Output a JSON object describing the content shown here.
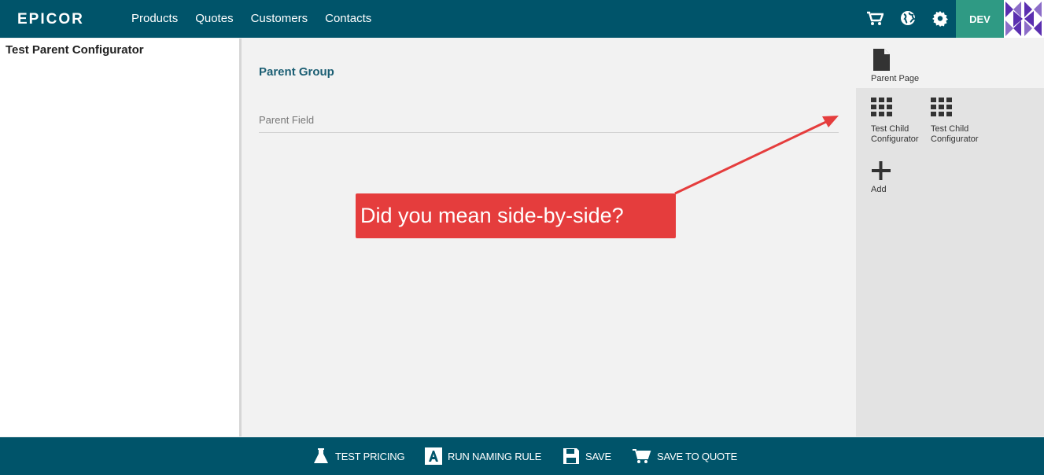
{
  "header": {
    "logo_text": "EPICOR",
    "nav": [
      "Products",
      "Quotes",
      "Customers",
      "Contacts"
    ],
    "env_badge": "DEV",
    "icons": [
      "cart-icon",
      "globe-icon",
      "gear-icon"
    ]
  },
  "sidebar": {
    "title": "Test Parent Configurator"
  },
  "main": {
    "group_title": "Parent Group",
    "field_label": "Parent Field"
  },
  "right_panel": {
    "page_label": "Parent Page",
    "children": [
      {
        "label_line1": "Test Child",
        "label_line2": "Configurator"
      },
      {
        "label_line1": "Test Child",
        "label_line2": "Configurator"
      }
    ],
    "add_label": "Add"
  },
  "footer": {
    "buttons": [
      "TEST PRICING",
      "RUN NAMING RULE",
      "SAVE",
      "SAVE TO QUOTE"
    ]
  },
  "annotation": {
    "text": "Did you mean side-by-side?",
    "color": "#e53d3d"
  },
  "colors": {
    "brand": "#00546a",
    "env": "#2f9a84",
    "title": "#1b5e73"
  }
}
